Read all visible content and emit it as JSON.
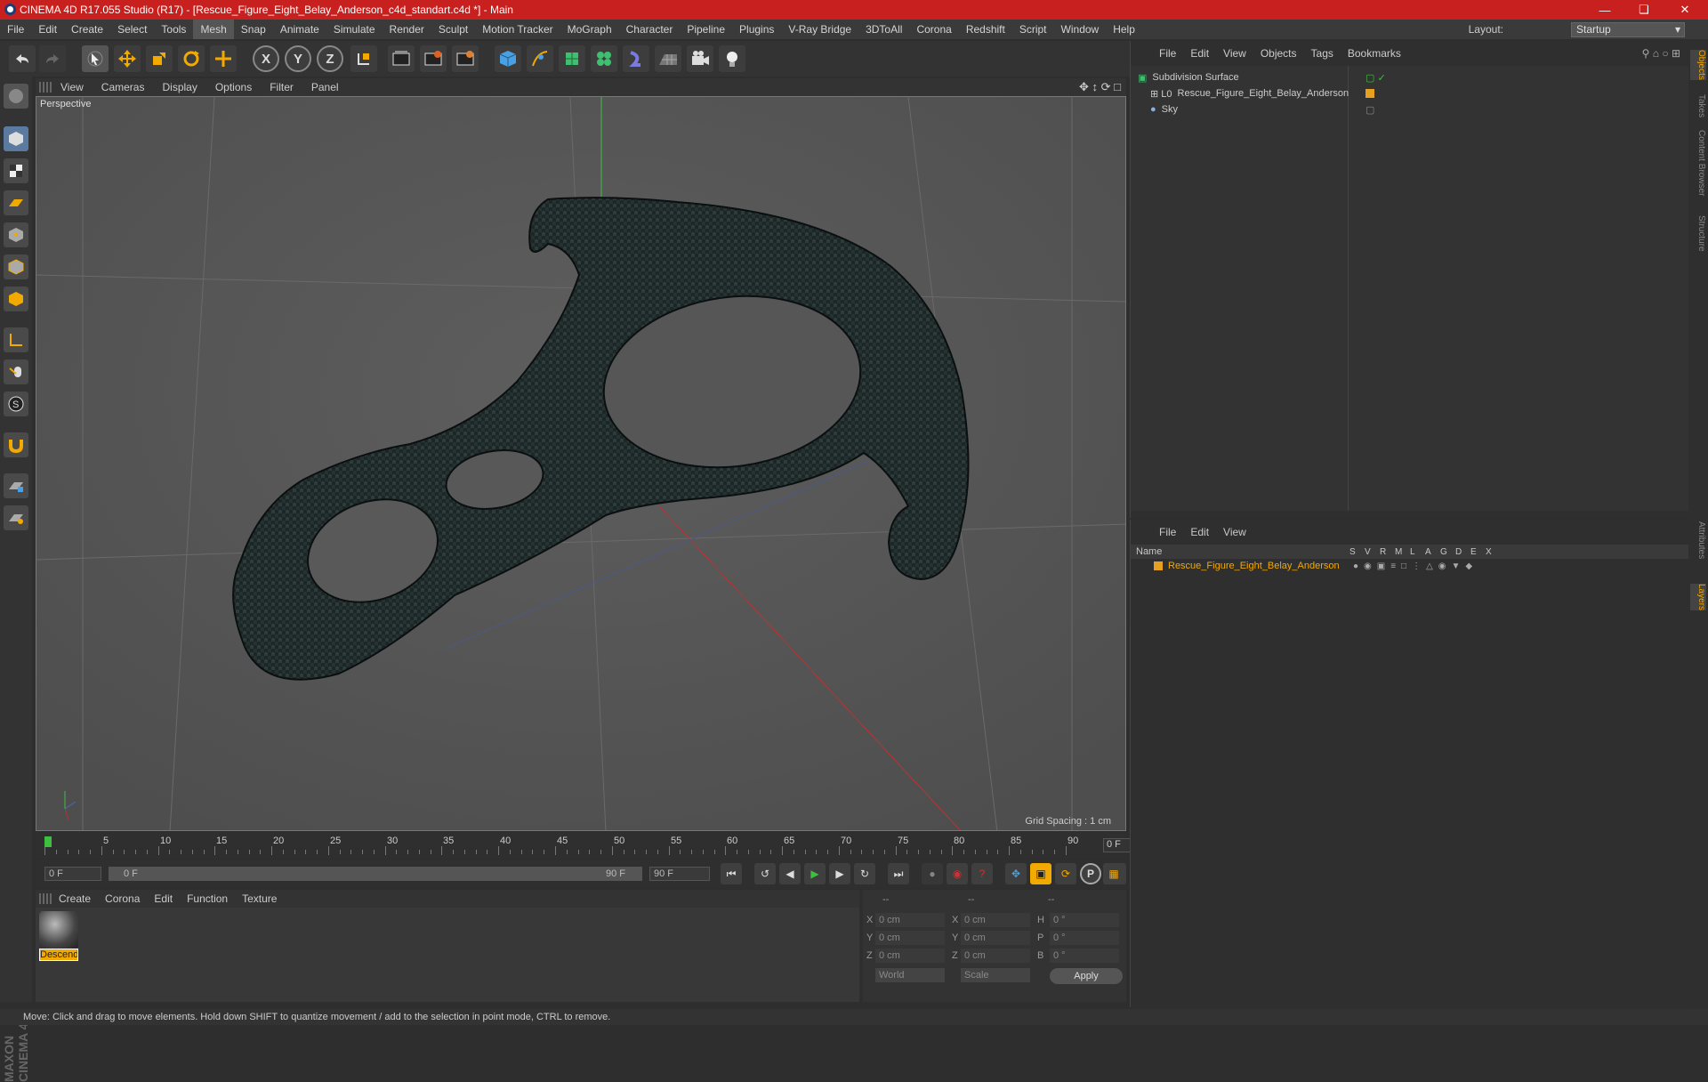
{
  "window": {
    "title": "CINEMA 4D R17.055 Studio (R17) - [Rescue_Figure_Eight_Belay_Anderson_c4d_standart.c4d *] - Main",
    "controls": [
      "minimize-icon",
      "restore-icon",
      "close-icon"
    ]
  },
  "menubar": {
    "items": [
      "File",
      "Edit",
      "Create",
      "Select",
      "Tools",
      "Mesh",
      "Snap",
      "Animate",
      "Simulate",
      "Render",
      "Sculpt",
      "Motion Tracker",
      "MoGraph",
      "Character",
      "Pipeline",
      "Plugins",
      "V-Ray Bridge",
      "3DToAll",
      "Corona",
      "Redshift",
      "Script",
      "Window",
      "Help"
    ],
    "active": "Mesh",
    "layout_label": "Layout:",
    "layout_value": "Startup"
  },
  "toolbar": {
    "icons": [
      "undo-icon",
      "redo-icon",
      "select-icon",
      "move-icon",
      "scale-icon",
      "rotate-icon",
      "transform-icon",
      "x-axis-icon",
      "y-axis-icon",
      "z-axis-icon",
      "coordinate-system-icon",
      "render-view-icon",
      "render-picture-viewer-icon",
      "edit-render-settings-icon",
      "cube-icon",
      "pen-icon",
      "subdivision-icon",
      "cloner-icon",
      "deformer-icon",
      "floor-icon",
      "camera-icon",
      "light-icon"
    ],
    "axis_labels": [
      "X",
      "Y",
      "Z"
    ]
  },
  "lefttools": {
    "icons": [
      "make-editable-icon",
      "model-mode-icon",
      "texture-mode-icon",
      "workplane-icon",
      "points-mode-icon",
      "edges-mode-icon",
      "polygons-mode-icon",
      "axis-mode-icon",
      "tweak-icon",
      "snap-icon",
      "magnet-icon",
      "workplane-lock-icon",
      "grid-lock-icon"
    ]
  },
  "viewport": {
    "menu": [
      "View",
      "Cameras",
      "Display",
      "Options",
      "Filter",
      "Panel"
    ],
    "label": "Perspective",
    "grid_spacing": "Grid Spacing : 1 cm"
  },
  "timeline": {
    "ticks": [
      "0",
      "5",
      "10",
      "15",
      "20",
      "25",
      "30",
      "35",
      "40",
      "45",
      "50",
      "55",
      "60",
      "65",
      "70",
      "75",
      "80",
      "85",
      "90"
    ],
    "current_frame": "0 F"
  },
  "transport": {
    "start_field": "0 F",
    "range_start": "0 F",
    "range_end": "90 F",
    "end_field": "90 F",
    "buttons": [
      "goto-start-icon",
      "prev-key-icon",
      "prev-frame-icon",
      "play-icon",
      "next-frame-icon",
      "goto-end-icon",
      "record-keys-icon",
      "auto-key-icon",
      "key-help-icon",
      "move-key-icon",
      "scale-key-icon",
      "rotate-key-icon",
      "param-key-icon",
      "pla-key-icon",
      "timeline-icon"
    ],
    "p_label": "P"
  },
  "material_manager": {
    "menu": [
      "Create",
      "Corona",
      "Edit",
      "Function",
      "Texture"
    ],
    "materials": [
      {
        "name": "Descend"
      }
    ]
  },
  "coordinates": {
    "header": [
      "--",
      "--",
      "--"
    ],
    "rows": [
      {
        "a": "X",
        "av": "0 cm",
        "b": "X",
        "bv": "0 cm",
        "c": "H",
        "cv": "0 °"
      },
      {
        "a": "Y",
        "av": "0 cm",
        "b": "Y",
        "bv": "0 cm",
        "c": "P",
        "cv": "0 °"
      },
      {
        "a": "Z",
        "av": "0 cm",
        "b": "Z",
        "bv": "0 cm",
        "c": "B",
        "cv": "0 °"
      }
    ],
    "mode": "World",
    "scale": "Scale",
    "apply": "Apply"
  },
  "object_manager": {
    "menu": [
      "File",
      "Edit",
      "View",
      "Objects",
      "Tags",
      "Bookmarks"
    ],
    "objects": [
      {
        "name": "Subdivision Surface",
        "icon": "subdivision-surface-icon"
      },
      {
        "name": "Rescue_Figure_Eight_Belay_Anderson",
        "icon": "null-object-icon"
      },
      {
        "name": "Sky",
        "icon": "sky-icon"
      }
    ]
  },
  "layer_manager": {
    "menu": [
      "File",
      "Edit",
      "View"
    ],
    "columns": [
      "Name",
      "S",
      "V",
      "R",
      "M",
      "L",
      "A",
      "G",
      "D",
      "E",
      "X"
    ],
    "layers": [
      {
        "name": "Rescue_Figure_Eight_Belay_Anderson",
        "color": "#e8a020"
      }
    ]
  },
  "right_tabs": [
    "Objects",
    "Takes",
    "Content Browser",
    "Structure",
    "Attributes",
    "Layers"
  ],
  "statusbar": "Move: Click and drag to move elements. Hold down SHIFT to quantize movement / add to the selection in point mode, CTRL to remove.",
  "maxon_logo": "MAXON CINEMA 4D",
  "colors": {
    "title_bar": "#c8201e",
    "accent": "#f2a900",
    "viewport_bg": "#565656"
  }
}
